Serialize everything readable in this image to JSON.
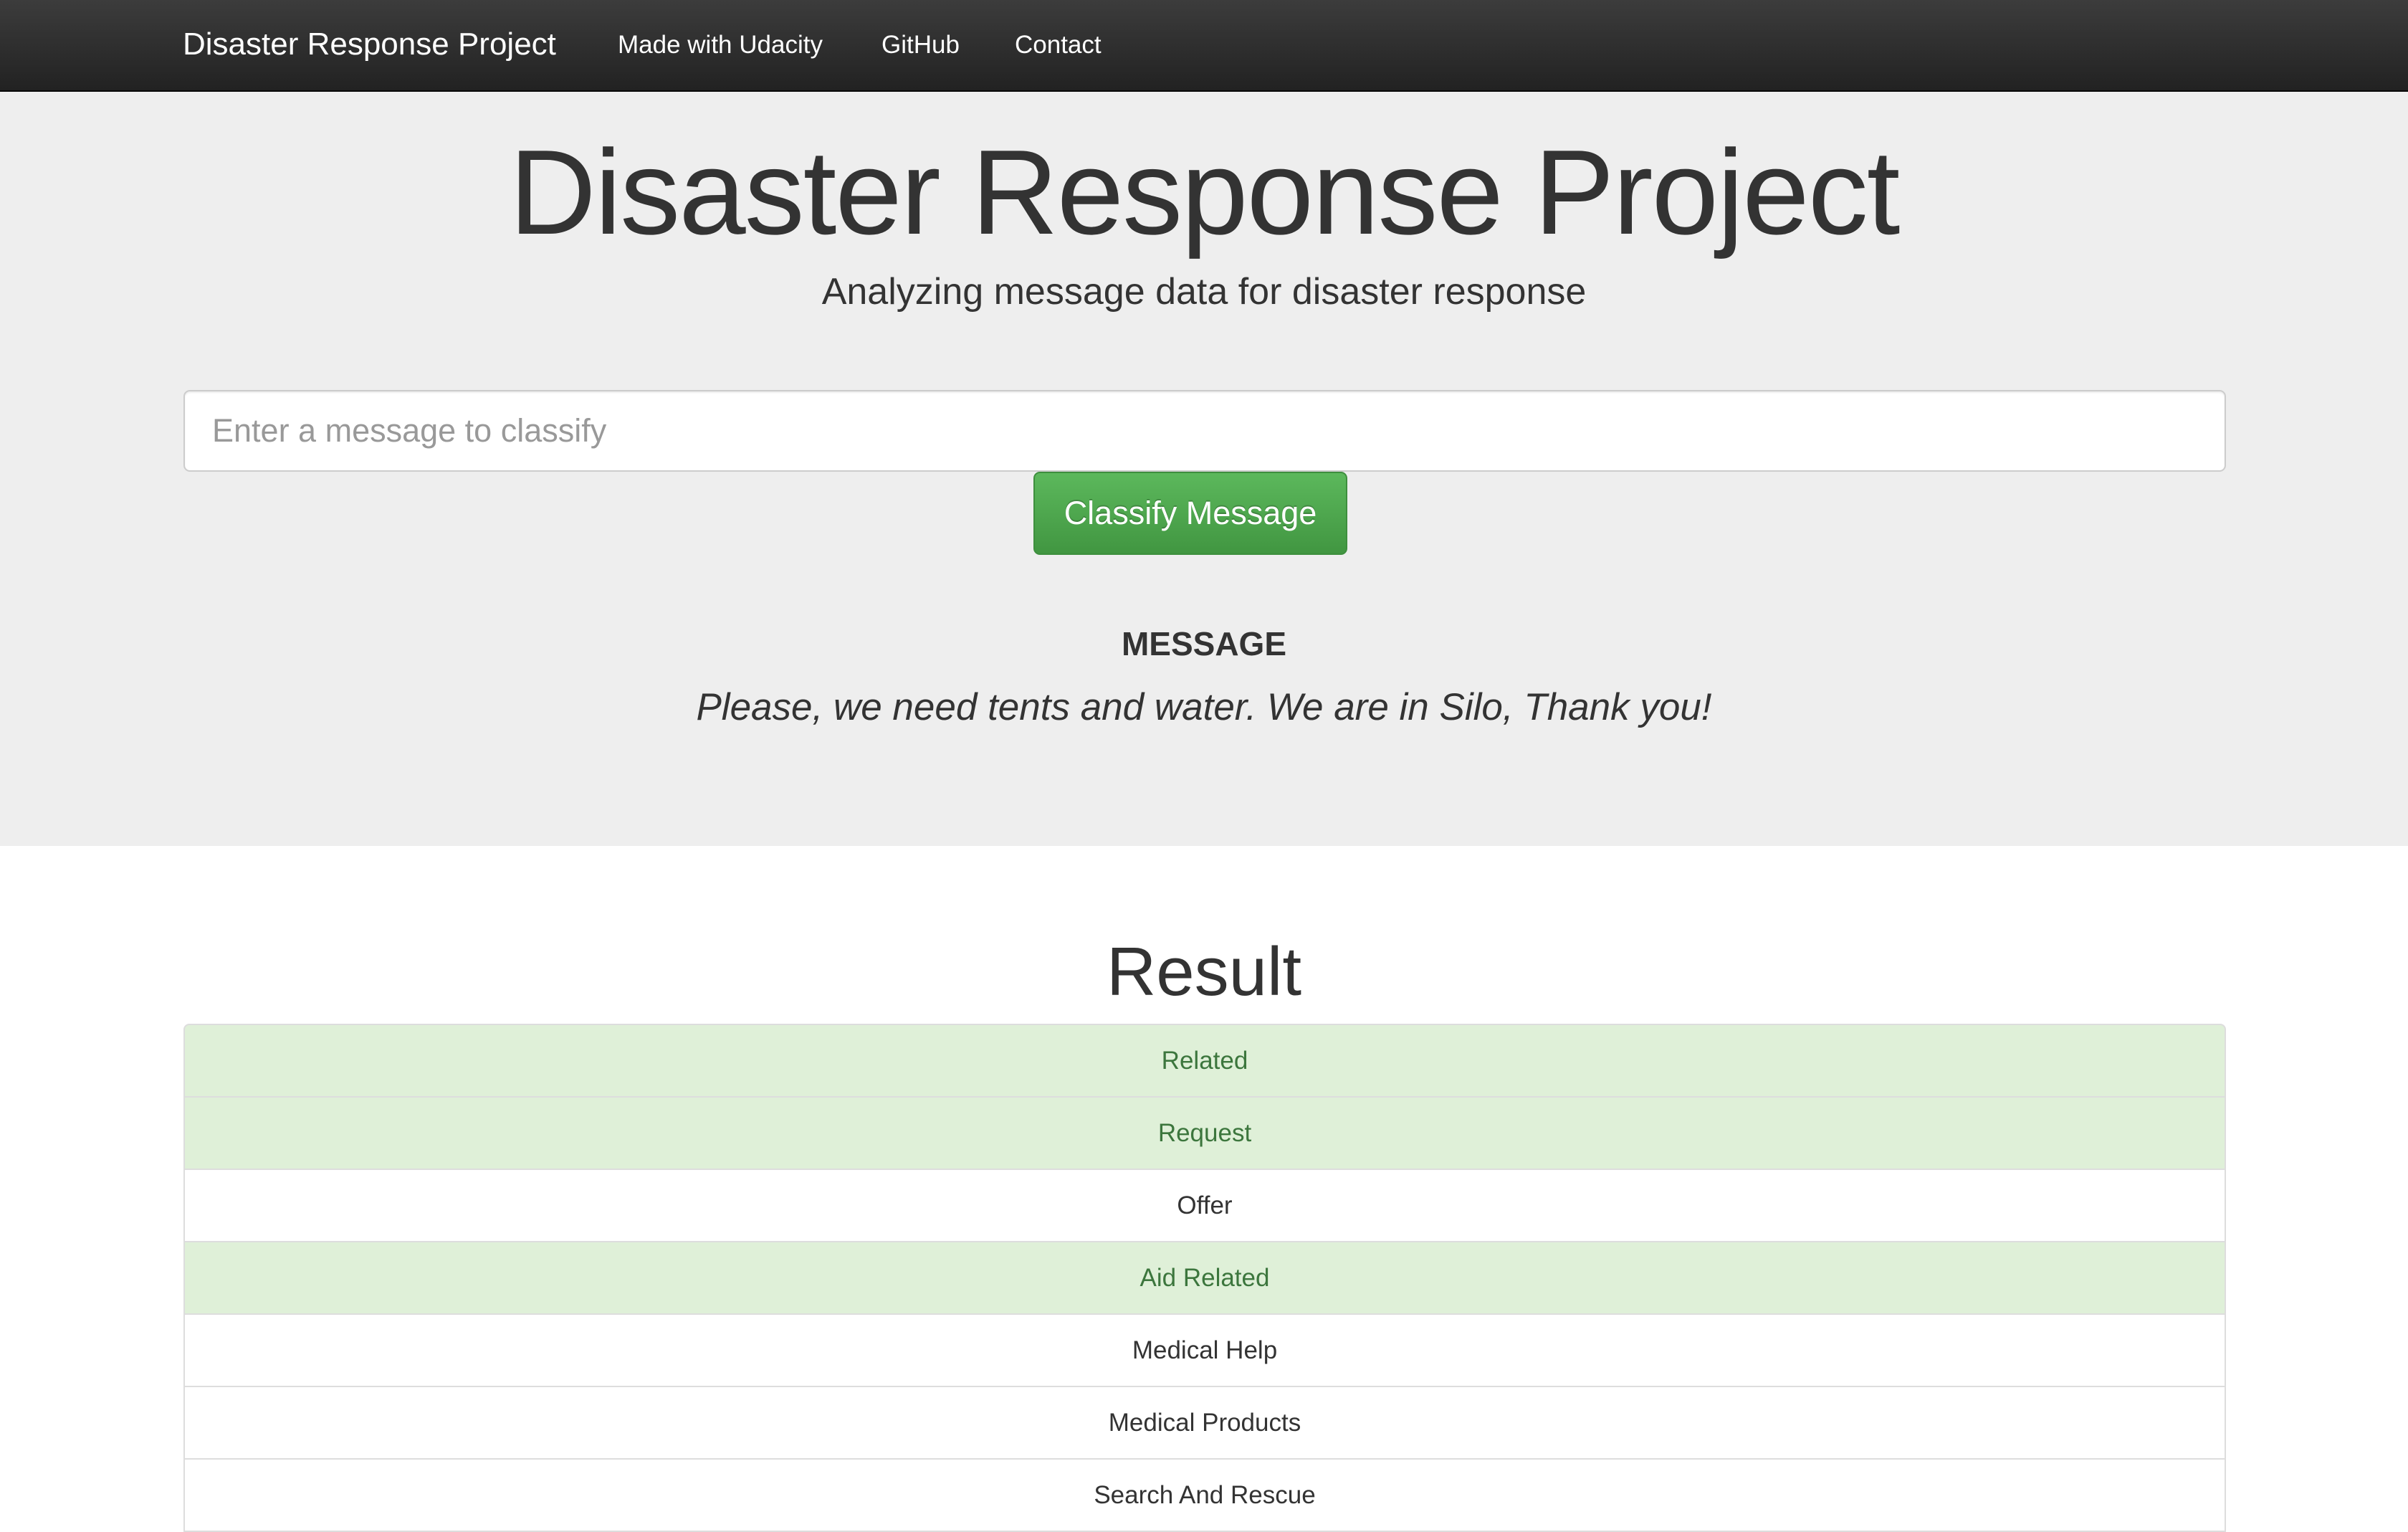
{
  "navbar": {
    "brand": "Disaster Response Project",
    "links": [
      {
        "label": "Made with Udacity"
      },
      {
        "label": "GitHub"
      },
      {
        "label": "Contact"
      }
    ]
  },
  "hero": {
    "title": "Disaster Response Project",
    "subtitle": "Analyzing message data for disaster response"
  },
  "classify_form": {
    "input_placeholder": "Enter a message to classify",
    "input_value": "",
    "button_label": "Classify Message"
  },
  "message": {
    "label": "MESSAGE",
    "text": "Please, we need tents and water. We are in Silo, Thank you!"
  },
  "result": {
    "title": "Result",
    "categories": [
      {
        "label": "Related",
        "matched": true
      },
      {
        "label": "Request",
        "matched": true
      },
      {
        "label": "Offer",
        "matched": false
      },
      {
        "label": "Aid Related",
        "matched": true
      },
      {
        "label": "Medical Help",
        "matched": false
      },
      {
        "label": "Medical Products",
        "matched": false
      },
      {
        "label": "Search And Rescue",
        "matched": false
      }
    ]
  },
  "colors": {
    "navbar_bg": "#222222",
    "jumbotron_bg": "#eeeeee",
    "success_bg": "#dff0d8",
    "success_text": "#3c763d",
    "button_green": "#5cb85c"
  }
}
